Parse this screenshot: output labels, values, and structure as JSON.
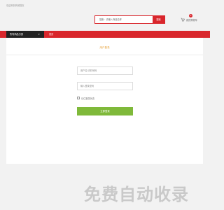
{
  "topbar": {
    "welcome": "欢迎来到商城首页"
  },
  "search": {
    "placeholder": "搜索：请输入商品名称",
    "button_label": "搜索"
  },
  "cart": {
    "badge_count": "0",
    "label": "我的购物车"
  },
  "nav": {
    "all_categories": "所有商品分类",
    "home": "首页"
  },
  "login": {
    "title": "用户登录",
    "account_placeholder": "用户名/手机号码",
    "password_placeholder": "输入登录密码",
    "remember_label": "记住登录状态",
    "submit_label": "立即登录"
  },
  "watermark": {
    "text": "免费自动收录"
  },
  "colors": {
    "brand_red": "#d9262c",
    "login_green": "#7fb93a",
    "title_orange": "#e6a23c",
    "nav_dark": "#222222"
  },
  "icons": {
    "cart": "cart-icon",
    "caret": "caret-down-icon"
  }
}
